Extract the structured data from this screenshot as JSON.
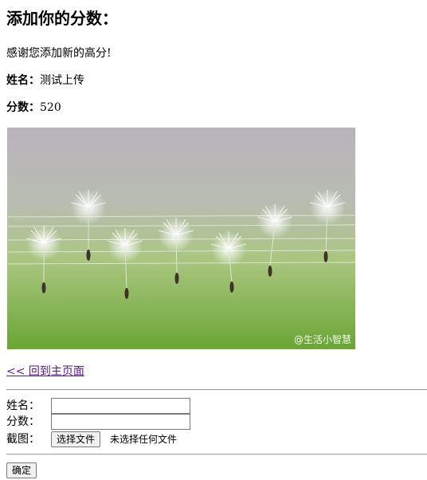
{
  "page": {
    "heading": "添加你的分数：",
    "thanks": "感谢您添加新的高分!"
  },
  "entry": {
    "name_label": "姓名：",
    "name_value": "测试上传",
    "score_label": "分数：",
    "score_value": "520",
    "image": {
      "icon": "dandelion-seeds-on-wires-photo",
      "watermark": "@生活小智慧",
      "colors": {
        "top": "#b9b3bd",
        "bottom": "#7fb04a"
      }
    }
  },
  "back_link": "<< 回到主页面",
  "form": {
    "name_label": "姓名：",
    "name_value": "",
    "score_label": "分数：",
    "score_value": "",
    "screenshot_label": "截图：",
    "file_button": "选择文件",
    "file_status": "未选择任何文件",
    "submit": "确定"
  }
}
